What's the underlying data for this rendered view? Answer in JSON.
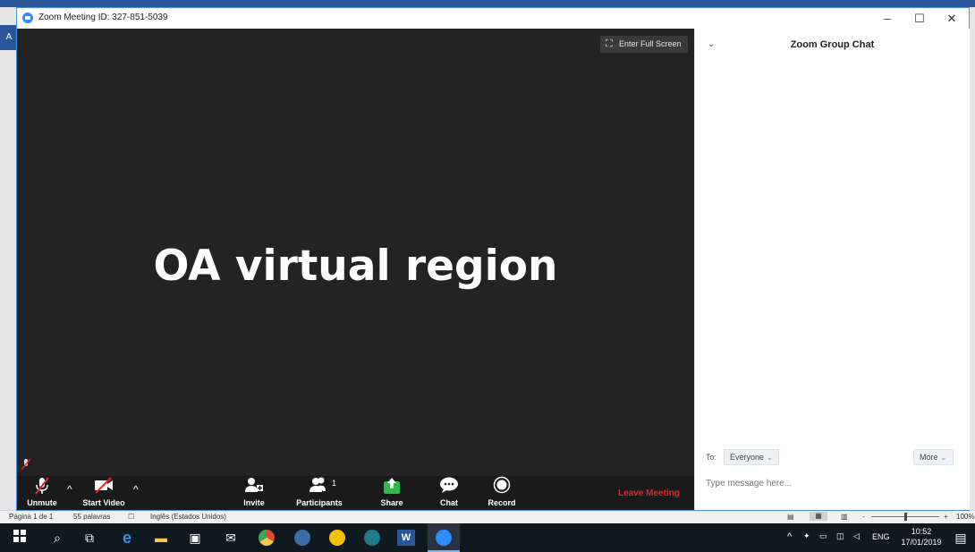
{
  "background_app": {
    "left_tab": "A"
  },
  "window": {
    "title": "Zoom Meeting ID: 327-851-5039",
    "minimize": "–",
    "maximize": "☐",
    "close": "✕"
  },
  "video": {
    "fullscreen_label": "Enter Full Screen",
    "meeting_name": "OA virtual region"
  },
  "toolbar": {
    "unmute": "Unmute",
    "start_video": "Start Video",
    "invite": "Invite",
    "participants": "Participants",
    "participants_count": "1",
    "share": "Share",
    "chat": "Chat",
    "record": "Record",
    "leave": "Leave Meeting"
  },
  "chat": {
    "title": "Zoom Group Chat",
    "to_label": "To:",
    "to_value": "Everyone",
    "more": "More",
    "placeholder": "Type message here..."
  },
  "word_status": {
    "page": "Página 1 de 1",
    "words": "55 palavras",
    "language": "Inglês (Estados Unidos)",
    "zoom_minus": "-",
    "zoom_plus": "+",
    "zoom": "100%"
  },
  "taskbar": {
    "language": "ENG",
    "time": "10:52",
    "date": "17/01/2019"
  },
  "colors": {
    "zoom_blue": "#2d8cff",
    "leave_red": "#e02828",
    "share_green": "#2fb94a"
  }
}
